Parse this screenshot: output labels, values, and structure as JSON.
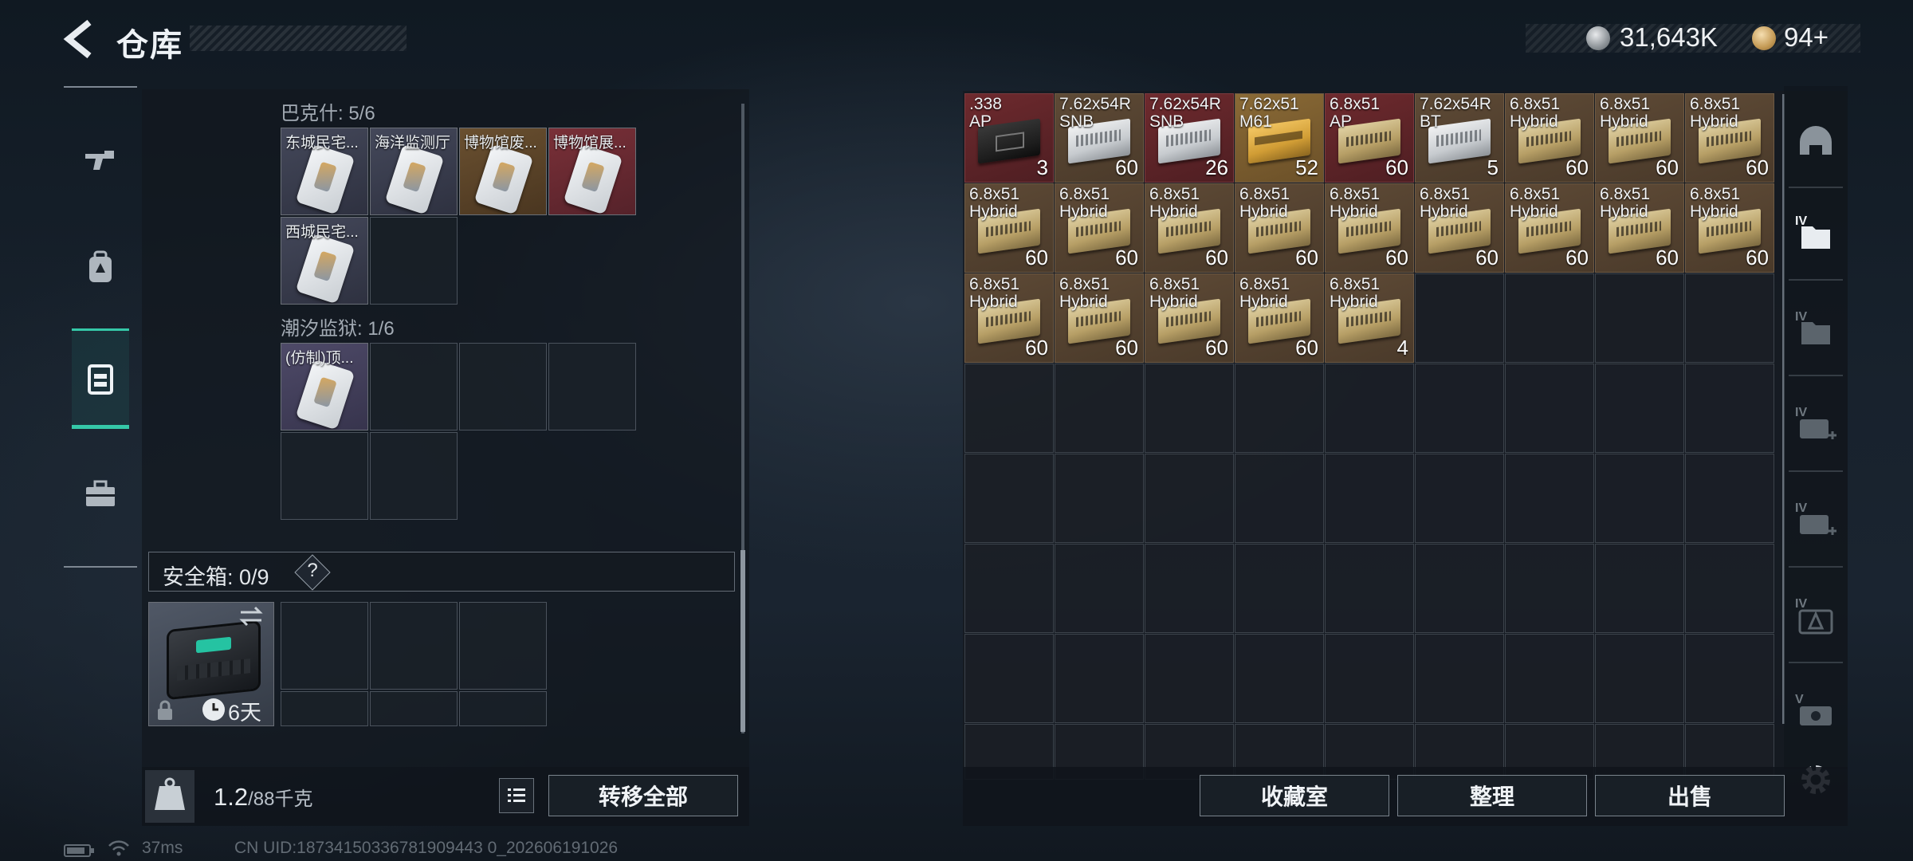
{
  "header": {
    "title": "仓库",
    "silver_amount": "31,643K",
    "gold_amount": "94+"
  },
  "left_nav": {
    "items": [
      {
        "name": "weapons",
        "icon": "rifle-icon"
      },
      {
        "name": "backpack",
        "icon": "backpack-icon"
      },
      {
        "name": "vest",
        "icon": "vest-icon",
        "active": true
      },
      {
        "name": "toolbox",
        "icon": "toolbox-icon"
      }
    ]
  },
  "keys": {
    "section1": {
      "label": "巴克什: 5/6",
      "items": [
        "东城民宅...",
        "海洋监测厅",
        "博物馆废...",
        "博物馆展...",
        "西城民宅..."
      ]
    },
    "section2": {
      "label": "潮汐监狱: 1/6",
      "items": [
        "(仿制)顶..."
      ]
    }
  },
  "safebox": {
    "label": "安全箱: 0/9",
    "help": "?",
    "days": "6天"
  },
  "footer_left": {
    "weight_value": "1.2",
    "weight_max": "/88千克",
    "transfer_all": "转移全部"
  },
  "footer_right": {
    "collection": "收藏室",
    "organize": "整理",
    "sell": "出售"
  },
  "stash": {
    "rows": [
      [
        {
          "label": ".338\nAP",
          "count": "3",
          "bg": "ab-red",
          "box": "box-black"
        },
        {
          "label": "7.62x54R\nSNB",
          "count": "60",
          "bg": "ab-brown",
          "box": "box-white"
        },
        {
          "label": "7.62x54R\nSNB",
          "count": "26",
          "bg": "ab-red",
          "box": "box-white"
        },
        {
          "label": "7.62x51\nM61",
          "count": "52",
          "bg": "ab-gold",
          "box": "box-yellow"
        },
        {
          "label": "6.8x51\nAP",
          "count": "60",
          "bg": "ab-red",
          "box": "box-tan"
        },
        {
          "label": "7.62x54R\nBT",
          "count": "5",
          "bg": "ab-brown",
          "box": "box-white"
        },
        {
          "label": "6.8x51\nHybrid",
          "count": "60",
          "bg": "ab-brown",
          "box": "box-tan"
        },
        {
          "label": "6.8x51\nHybrid",
          "count": "60",
          "bg": "ab-brown",
          "box": "box-tan"
        },
        {
          "label": "6.8x51\nHybrid",
          "count": "60",
          "bg": "ab-brown",
          "box": "box-tan"
        }
      ],
      [
        {
          "label": "6.8x51\nHybrid",
          "count": "60",
          "bg": "ab-brown",
          "box": "box-tan"
        },
        {
          "label": "6.8x51\nHybrid",
          "count": "60",
          "bg": "ab-brown",
          "box": "box-tan"
        },
        {
          "label": "6.8x51\nHybrid",
          "count": "60",
          "bg": "ab-brown",
          "box": "box-tan"
        },
        {
          "label": "6.8x51\nHybrid",
          "count": "60",
          "bg": "ab-brown",
          "box": "box-tan"
        },
        {
          "label": "6.8x51\nHybrid",
          "count": "60",
          "bg": "ab-brown",
          "box": "box-tan"
        },
        {
          "label": "6.8x51\nHybrid",
          "count": "60",
          "bg": "ab-brown",
          "box": "box-tan"
        },
        {
          "label": "6.8x51\nHybrid",
          "count": "60",
          "bg": "ab-brown",
          "box": "box-tan"
        },
        {
          "label": "6.8x51\nHybrid",
          "count": "60",
          "bg": "ab-brown",
          "box": "box-tan"
        },
        {
          "label": "6.8x51\nHybrid",
          "count": "60",
          "bg": "ab-brown",
          "box": "box-tan"
        }
      ],
      [
        {
          "label": "6.8x51\nHybrid",
          "count": "60",
          "bg": "ab-brown",
          "box": "box-tan"
        },
        {
          "label": "6.8x51\nHybrid",
          "count": "60",
          "bg": "ab-brown",
          "box": "box-tan"
        },
        {
          "label": "6.8x51\nHybrid",
          "count": "60",
          "bg": "ab-brown",
          "box": "box-tan"
        },
        {
          "label": "6.8x51\nHybrid",
          "count": "60",
          "bg": "ab-brown",
          "box": "box-tan"
        },
        {
          "label": "6.8x51\nHybrid",
          "count": "4",
          "bg": "ab-brown",
          "box": "box-tan"
        }
      ]
    ]
  },
  "right_sidebar": {
    "items": [
      "helmet-icon",
      "stash-tab-1-icon",
      "stash-tab-2-icon",
      "stash-tab-3-icon",
      "stash-tab-4-icon",
      "stash-tab-5-icon",
      "stash-tab-6-icon",
      "settings-gear-icon"
    ],
    "labels": [
      "",
      "IV",
      "IV",
      "IV",
      "IV",
      "IV",
      "V",
      ""
    ]
  },
  "status_bar": {
    "ping": "37ms",
    "uid": "CN UID:18734150336781909443 0_202606191026"
  }
}
